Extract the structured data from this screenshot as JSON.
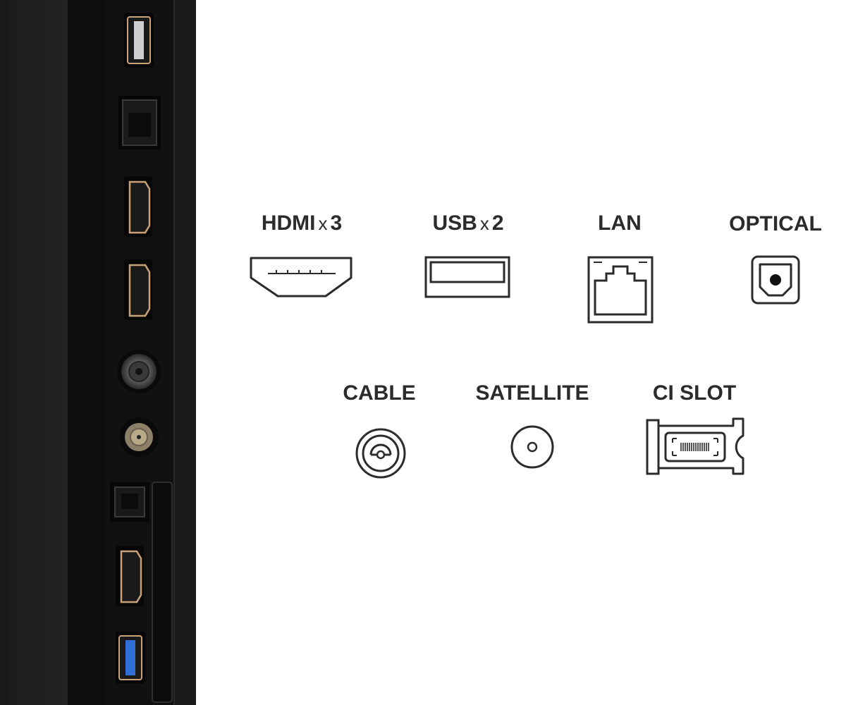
{
  "ports": [
    {
      "id": "hdmi",
      "name": "HDMI",
      "mult": "x",
      "count": "3",
      "icon": "hdmi-port-icon"
    },
    {
      "id": "usb",
      "name": "USB",
      "mult": "x",
      "count": "2",
      "icon": "usb-port-icon"
    },
    {
      "id": "lan",
      "name": "LAN",
      "mult": "",
      "count": "",
      "icon": "lan-port-icon"
    },
    {
      "id": "optical",
      "name": "OPTICAL",
      "mult": "",
      "count": "",
      "icon": "optical-port-icon"
    },
    {
      "id": "cable",
      "name": "CABLE",
      "mult": "",
      "count": "",
      "icon": "cable-port-icon"
    },
    {
      "id": "satellite",
      "name": "SATELLITE",
      "mult": "",
      "count": "",
      "icon": "satellite-port-icon"
    },
    {
      "id": "ci-slot",
      "name": "CI SLOT",
      "mult": "",
      "count": "",
      "icon": "ci-slot-icon"
    }
  ],
  "colors": {
    "background": "#ffffff",
    "text": "#2b2b2b",
    "tv_body": "#141414",
    "port_trim": "#c9a27a",
    "usb_blue": "#2f6fd6"
  }
}
